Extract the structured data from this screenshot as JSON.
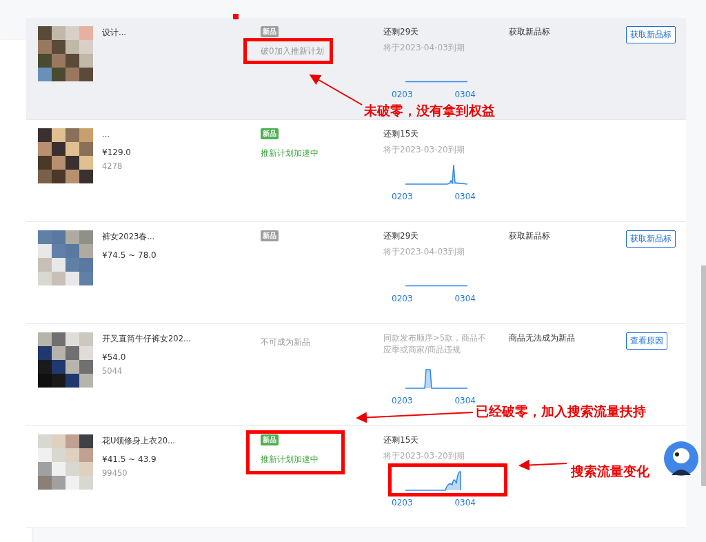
{
  "rows": [
    {
      "highlighted": true,
      "title": "设计...",
      "tag": {
        "label": "新品",
        "active": false
      },
      "status": "破0加入推新计划",
      "remaining": "还剩29天",
      "expires": "将于2023-04-03到期",
      "x_labels": [
        "0203",
        "0304"
      ],
      "label": "获取新品标",
      "button": "获取新品标"
    },
    {
      "highlighted": false,
      "title": "...",
      "price": "¥129.0",
      "id_text": "4278",
      "tag": {
        "label": "新品",
        "active": true
      },
      "status": "推新计划加速中",
      "remaining": "还剩15天",
      "expires": "将于2023-03-20到期",
      "x_labels": [
        "0203",
        "0304"
      ]
    },
    {
      "highlighted": false,
      "title": "裤女2023春...",
      "price": "¥74.5 ~ 78.0",
      "tag": {
        "label": "新品",
        "active": false
      },
      "remaining": "还剩29天",
      "expires": "将于2023-04-03到期",
      "x_labels": [
        "0203",
        "0304"
      ],
      "label": "获取新品标",
      "button": "获取新品标"
    },
    {
      "highlighted": false,
      "title": "开叉直筒牛仔裤女202...",
      "price": "¥54.0",
      "id_text": "5044",
      "status": "不可成为新品",
      "note": "同款发布顺序>5款，商品不应季或商家/商品违规",
      "x_labels": [
        "0203",
        "0304"
      ],
      "label": "商品无法成为新品",
      "button": "查看原因"
    },
    {
      "highlighted": false,
      "title": "花U领修身上衣20...",
      "price": "¥41.5 ~ 43.9",
      "id_text": "99450",
      "tag": {
        "label": "新品",
        "active": true
      },
      "status": "推新计划加速中",
      "remaining": "还剩15天",
      "expires": "将于2023-03-20到期",
      "x_labels": [
        "0203",
        "0304"
      ]
    }
  ],
  "annotations": [
    "未破零，没有拿到权益",
    "已经破零，加入搜索流量扶持",
    "搜索流量变化"
  ]
}
